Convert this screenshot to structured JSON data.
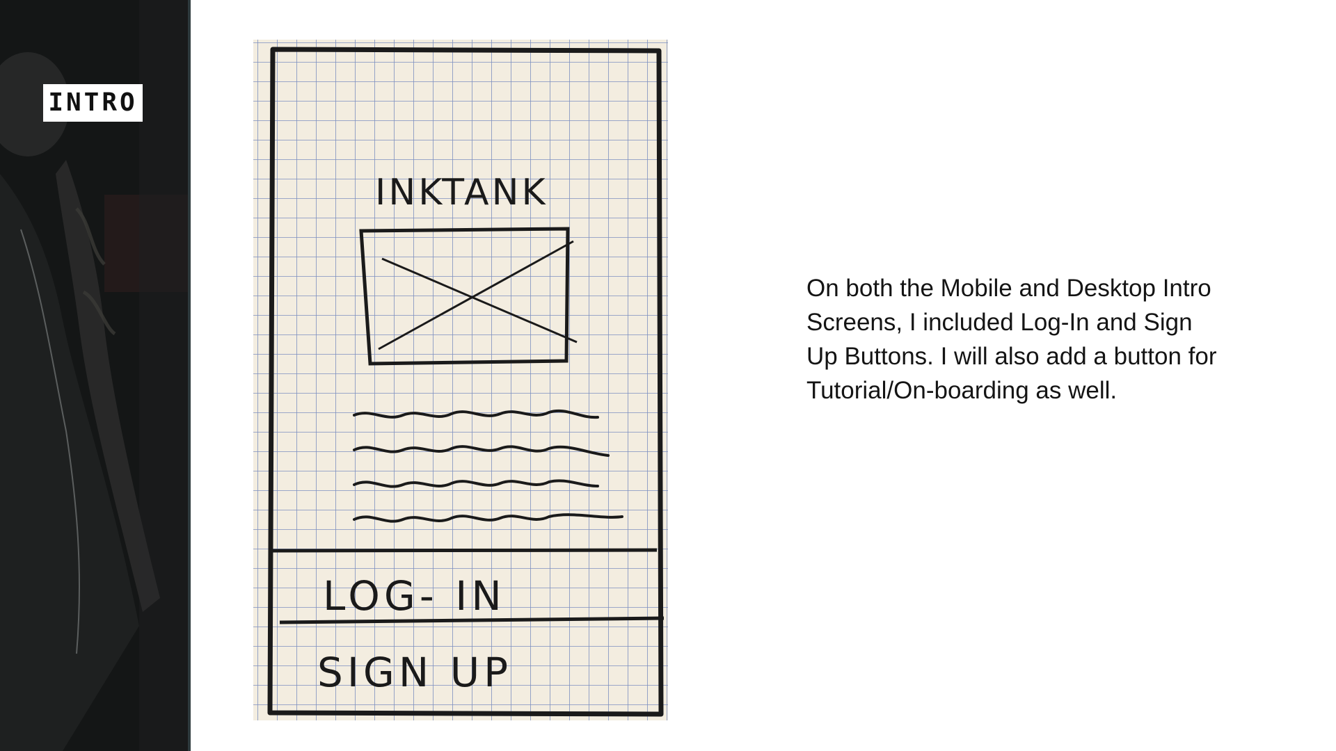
{
  "slide": {
    "section_label": "INTRO",
    "description": "On both the Mobile and Desktop Intro Screens, I included Log-In and Sign Up Buttons.  I will also add a button for Tutorial/On-boarding as well."
  },
  "sketch": {
    "app_name": "INKTANK",
    "login_label": "LOG- IN",
    "signup_label": "SIGN UP",
    "paper_color": "#f3ede0",
    "grid_color": "#7c8fbf",
    "ink_color": "#1a1a1a"
  },
  "sidebar": {
    "background_color": "#161818",
    "photo_icon": "tattooed-person-photo"
  }
}
